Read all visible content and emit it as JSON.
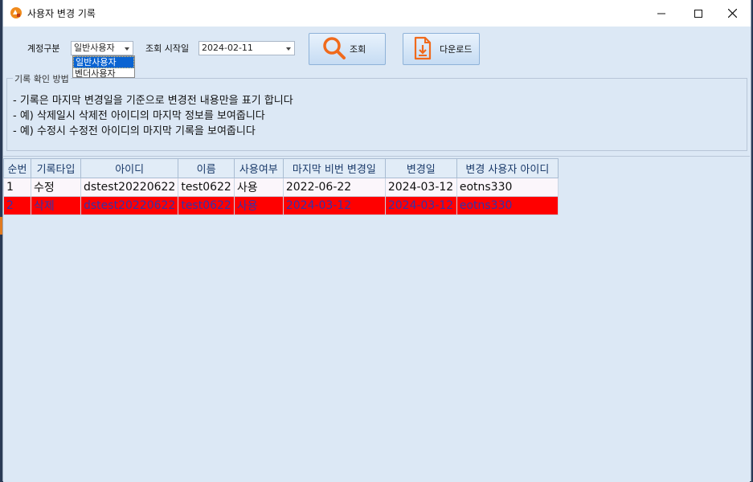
{
  "window": {
    "title": "사용자 변경 기록"
  },
  "filters": {
    "account_type_label": "계정구분",
    "account_type_value": "일반사용자",
    "account_type_options": [
      "일반사용자",
      "벤더사용자"
    ],
    "start_date_label": "조회 시작일",
    "start_date_value": "2024-02-11"
  },
  "buttons": {
    "search_label": "조회",
    "download_label": "다운로드"
  },
  "info": {
    "group_title": "기록 확인 방법",
    "lines": [
      "- 기록은 마지막 변경일을 기준으로 변경전 내용만을 표기 합니다",
      "- 예) 삭제일시 삭제전 아이디의 마지막 정보를 보여줍니다",
      "- 예) 수정시 수정전 아이디의 마지막 기록을 보여줍니다"
    ]
  },
  "table": {
    "columns": [
      "순번",
      "기록타입",
      "아이디",
      "이름",
      "사용여부",
      "마지막 비번 변경일",
      "변경일",
      "변경 사용자 아이디"
    ],
    "rows": [
      [
        "1",
        "수정",
        "dstest20220622",
        "test0622",
        "사용",
        "2022-06-22",
        "2024-03-12",
        "eotns330"
      ],
      [
        "2",
        "삭제",
        "dstest20220622",
        "test0622",
        "사용",
        "2024-03-12",
        "2024-03-12",
        "eotns330"
      ]
    ]
  },
  "colors": {
    "deleted_row_bg": "#ff0000",
    "window_bg": "#dce8f5"
  }
}
